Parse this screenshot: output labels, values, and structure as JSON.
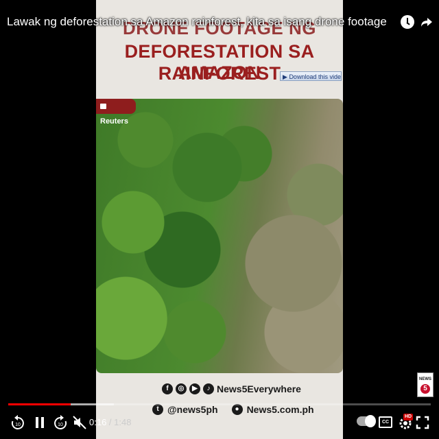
{
  "video": {
    "title": "Lawak ng deforestation sa Amazon rainforest, kita sa isang drone footage"
  },
  "frame": {
    "headline_line1": "DRONE FOOTAGE NG",
    "headline_line2": "DEFORESTATION SA AMAZON",
    "headline_line3": "RAINFOREST",
    "download_label": "Download this video",
    "source_tag": "Reuters",
    "social_row1": {
      "icons": [
        "facebook-icon",
        "instagram-icon",
        "youtube-icon",
        "tiktok-icon"
      ],
      "text": "News5Everywhere"
    },
    "social_row2": {
      "twitter_handle": "@news5ph",
      "website": "News5.com.ph"
    },
    "logo_text": "NEWS",
    "logo_number": "5"
  },
  "player": {
    "current_time": "0:16",
    "separator": " / ",
    "duration": "1:48",
    "progress_played_fraction": 0.148,
    "progress_loaded_fraction": 0.25,
    "cc_label": "CC",
    "hd_label": "HD",
    "accent_color": "#ff0000"
  }
}
